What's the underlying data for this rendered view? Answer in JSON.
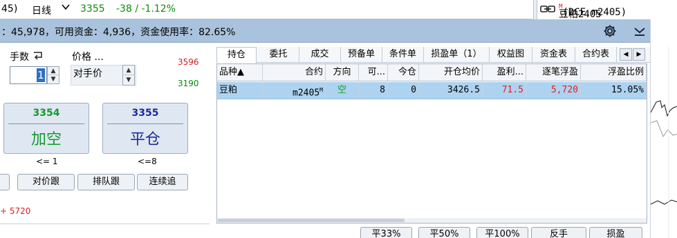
{
  "topbar": {
    "tail": "45)",
    "period": "日线",
    "price": "3355",
    "change": "-38 / -1.12%",
    "symbol_name": "豆粕2405",
    "symbol_sup": "M",
    "symbol_exchange": "(DCE m2405)",
    "price_color": "#0a8a0a"
  },
  "mainbar": {
    "summary": "：45,978，可用资金：4,936，资金使用率：82.65%",
    "bg_color": "#a9c2dd"
  },
  "order": {
    "qty_label": "手数",
    "price_label": "价格 ...",
    "qty_value": "1",
    "price_mode": "对手价",
    "limit_up": "3596",
    "limit_down": "3190",
    "open_short": {
      "price": "3354",
      "label": "加空",
      "limit": "<= 1"
    },
    "close": {
      "price": "3355",
      "label": "平仓",
      "limit": "<=8"
    },
    "buttons": [
      "对价跟",
      "排队跟",
      "连续追"
    ],
    "floating_pnl": "+ 5720"
  },
  "tabs": [
    "持仓",
    "委托",
    "成交",
    "预备单",
    "条件单",
    "损盈单（1）",
    "权益图",
    "资金表",
    "合约表"
  ],
  "tab_arrows": [
    "◀",
    "▶"
  ],
  "grid": {
    "columns": [
      "品种▲",
      "合约",
      "方向",
      "可...",
      "今仓",
      "开仓均价",
      "盈利...",
      "逐笔浮盈",
      "浮盈比例"
    ],
    "row": {
      "variety": "豆粕",
      "contract": "m2405",
      "contract_sup": "M",
      "direction": "空",
      "available": "8",
      "today": "0",
      "avg_open": "3426.5",
      "profit": "71.5",
      "floating_pnl": "5,720",
      "pnl_ratio": "15.05%"
    },
    "selected_row_color": "#aed3f0"
  },
  "actions": [
    "平33%",
    "平50%",
    "平100%",
    "反手",
    "损盈"
  ]
}
